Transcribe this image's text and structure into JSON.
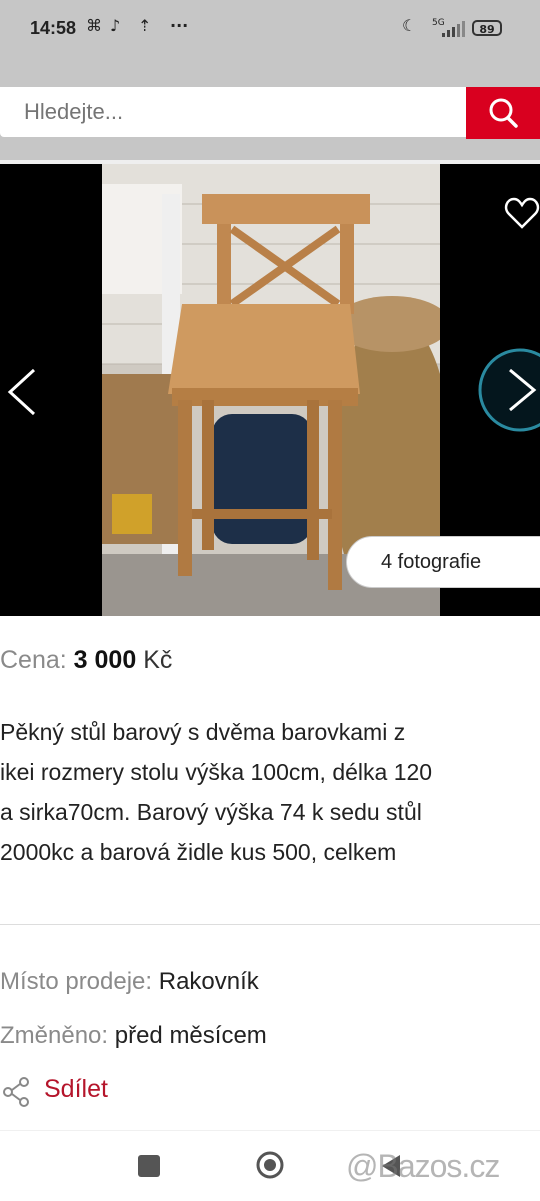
{
  "status_bar": {
    "time": "14:58",
    "battery": "89",
    "network": "5G",
    "icons": [
      "notification-icon",
      "tiktok-icon",
      "upload-icon",
      "more-icon",
      "moon-icon",
      "signal-icon",
      "battery-icon"
    ]
  },
  "search": {
    "placeholder": "Hledejte...",
    "button_icon": "search-icon",
    "accent": "#d9001f"
  },
  "listing": {
    "photo_count_label": "4 fotografie",
    "price_label": "Cena:",
    "price_value": "3 000",
    "currency": "Kč",
    "description_lines": [
      "Pěkný stůl barový s dvěma barovkami z",
      "ikei rozmery stolu výška 100cm, délka 120",
      "a sirka70cm. Barový výška 74 k sedu stůl",
      "2000kc a barová židle kus 500, celkem"
    ],
    "location_label": "Místo prodeje:",
    "location_value": "Rakovník",
    "changed_label": "Změněno:",
    "changed_value": "před měsícem",
    "share_label": "Sdílet",
    "share_color": "#b5152b"
  },
  "watermark": "@Bazos.cz"
}
